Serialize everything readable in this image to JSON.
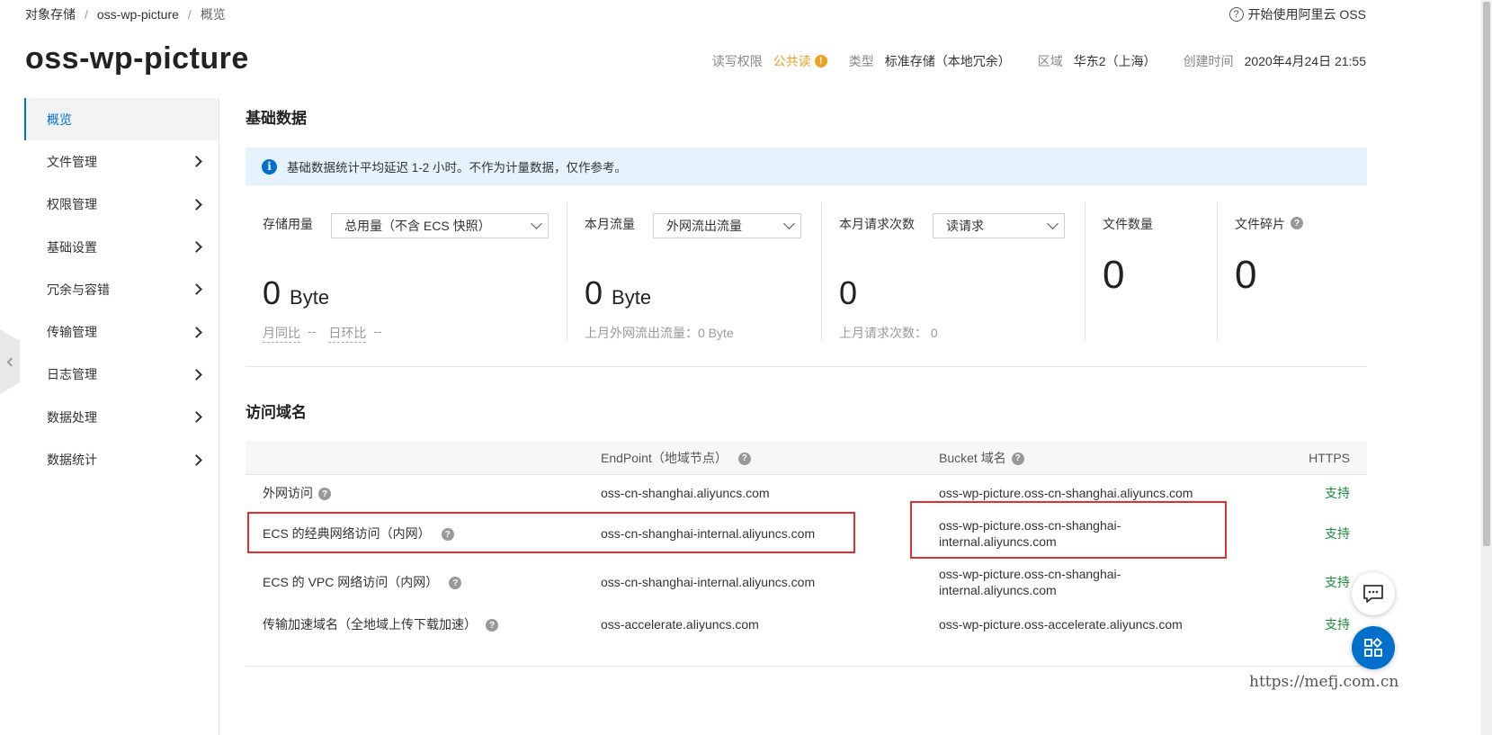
{
  "breadcrumb": [
    "对象存储",
    "oss-wp-picture",
    "概览"
  ],
  "help_link": "开始使用阿里云 OSS",
  "bucket_name": "oss-wp-picture",
  "meta": {
    "acl_label": "读写权限",
    "acl_value": "公共读",
    "type_label": "类型",
    "type_value": "标准存储（本地冗余）",
    "region_label": "区域",
    "region_value": "华东2（上海）",
    "created_label": "创建时间",
    "created_value": "2020年4月24日 21:55"
  },
  "sidebar": {
    "items": [
      {
        "label": "概览"
      },
      {
        "label": "文件管理"
      },
      {
        "label": "权限管理"
      },
      {
        "label": "基础设置"
      },
      {
        "label": "冗余与容错"
      },
      {
        "label": "传输管理"
      },
      {
        "label": "日志管理"
      },
      {
        "label": "数据处理"
      },
      {
        "label": "数据统计"
      }
    ]
  },
  "basic": {
    "title": "基础数据",
    "notice": "基础数据统计平均延迟 1-2 小时。不作为计量数据，仅作参考。",
    "storage": {
      "label": "存储用量",
      "select": "总用量（不含 ECS 快照）",
      "value": "0",
      "unit": "Byte",
      "mom": "月同比",
      "mom_val": "--",
      "dod": "日环比",
      "dod_val": "--"
    },
    "traffic": {
      "label": "本月流量",
      "select": "外网流出流量",
      "value": "0",
      "unit": "Byte",
      "sub": "上月外网流出流量：0 Byte"
    },
    "requests": {
      "label": "本月请求次数",
      "select": "读请求",
      "value": "0",
      "sub": "上月请求次数：  0"
    },
    "files": {
      "label": "文件数量",
      "value": "0"
    },
    "fragments": {
      "label": "文件碎片",
      "value": "0"
    }
  },
  "domains": {
    "title": "访问域名",
    "headers": {
      "endpoint": "EndPoint（地域节点）",
      "bucket": "Bucket 域名",
      "https": "HTTPS"
    },
    "rows": [
      {
        "name": "外网访问",
        "endpoint": "oss-cn-shanghai.aliyuncs.com",
        "bucket_domain": "oss-wp-picture.oss-cn-shanghai.aliyuncs.com",
        "https": "支持"
      },
      {
        "name": "ECS 的经典网络访问（内网）",
        "endpoint": "oss-cn-shanghai-internal.aliyuncs.com",
        "bucket_domain": "oss-wp-picture.oss-cn-shanghai-internal.aliyuncs.com",
        "https": "支持"
      },
      {
        "name": "ECS 的 VPC 网络访问（内网）",
        "endpoint": "oss-cn-shanghai-internal.aliyuncs.com",
        "bucket_domain": "oss-wp-picture.oss-cn-shanghai-internal.aliyuncs.com",
        "https": "支持"
      },
      {
        "name": "传输加速域名（全地域上传下载加速）",
        "endpoint": "oss-accelerate.aliyuncs.com",
        "bucket_domain": "oss-wp-picture.oss-accelerate.aliyuncs.com",
        "https": "支持"
      }
    ]
  },
  "watermark": "https://mefj.com.cn",
  "colors": {
    "accent": "#0070cc",
    "warning": "#f0a020",
    "success": "#1b8a3a",
    "highlight": "#e03030",
    "notice_bg": "#e6f3fd"
  }
}
